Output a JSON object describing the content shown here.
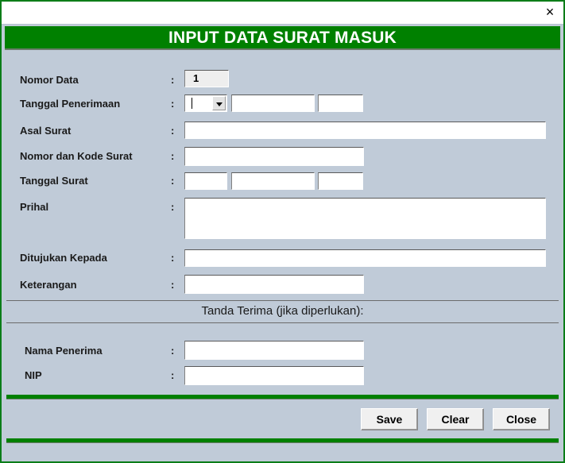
{
  "window": {
    "close_icon": "×",
    "banner_title": "INPUT DATA SURAT MASUK",
    "accent_green": "#008000",
    "body_background": "#c0cbd8"
  },
  "form": {
    "colon": ":",
    "rows": [
      {
        "label": "Nomor Data",
        "value": "1",
        "placeholder": ""
      },
      {
        "label": "Tanggal Penerimaan",
        "value": "",
        "placeholder": ""
      },
      {
        "label": "Asal Surat",
        "value": "",
        "placeholder": ""
      },
      {
        "label": "Nomor dan Kode Surat",
        "value": "",
        "placeholder": ""
      },
      {
        "label": "Tanggal Surat",
        "value": "",
        "placeholder": ""
      },
      {
        "label": "Prihal",
        "value": "",
        "placeholder": ""
      },
      {
        "label": "Ditujukan Kepada",
        "value": "",
        "placeholder": ""
      },
      {
        "label": "Keterangan",
        "value": "",
        "placeholder": ""
      }
    ],
    "date_penerimaan": {
      "day": "",
      "month": "",
      "year": ""
    },
    "date_surat": {
      "day": "",
      "month": "",
      "year": ""
    }
  },
  "receipt_section": {
    "title": "Tanda Terima (jika diperlukan):",
    "rows": [
      {
        "label": "Nama Penerima",
        "value": "",
        "placeholder": ""
      },
      {
        "label": "NIP",
        "value": "",
        "placeholder": ""
      }
    ]
  },
  "buttons": {
    "save": "Save",
    "clear": "Clear",
    "close": "Close"
  }
}
